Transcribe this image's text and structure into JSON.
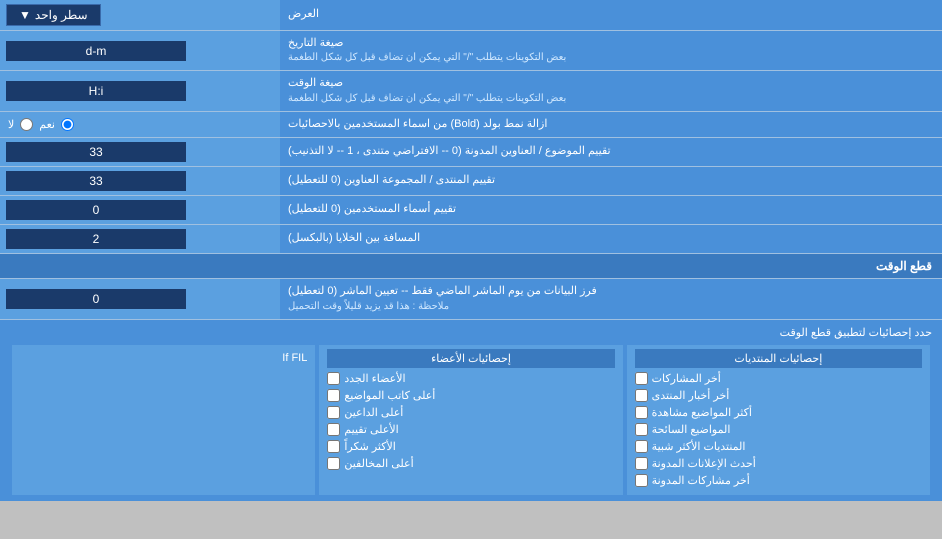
{
  "rows": [
    {
      "id": "display-mode",
      "label": "العرض",
      "input_type": "dropdown",
      "input_value": "سطر واحد"
    },
    {
      "id": "date-format",
      "label": "صيغة التاريخ",
      "sub_label": "بعض التكوينات يتطلب \"/\" التي يمكن ان تضاف قبل كل شكل الطغمة",
      "input_type": "text",
      "input_value": "d-m"
    },
    {
      "id": "time-format",
      "label": "صيغة الوقت",
      "sub_label": "بعض التكوينات يتطلب \"/\" التي يمكن ان تضاف قبل كل شكل الطغمة",
      "input_type": "text",
      "input_value": "H:i"
    },
    {
      "id": "bold-remove",
      "label": "ازالة نمط بولد (Bold) من اسماء المستخدمين بالاحصائيات",
      "input_type": "radio",
      "options": [
        "نعم",
        "لا"
      ],
      "selected": "نعم"
    },
    {
      "id": "topic-order",
      "label": "تقييم الموضوع / العناوين المدونة (0 -- الافتراضي متندى ، 1 -- لا التذنيب)",
      "input_type": "text",
      "input_value": "33"
    },
    {
      "id": "forum-order",
      "label": "تقييم المنتدى / المجموعة العناوين (0 للتعطيل)",
      "input_type": "text",
      "input_value": "33"
    },
    {
      "id": "usernames-order",
      "label": "تقييم أسماء المستخدمين (0 للتعطيل)",
      "input_type": "text",
      "input_value": "0"
    },
    {
      "id": "cell-spacing",
      "label": "المسافة بين الخلايا (بالبكسل)",
      "input_type": "text",
      "input_value": "2"
    }
  ],
  "section_cutoff": {
    "title": "قطع الوقت",
    "row_label": "فرز البيانات من يوم الماشر الماضي فقط -- تعيين الماشر (0 لتعطيل)",
    "note": "ملاحظة : هذا قد يزيد قليلاً وقت التحميل",
    "input_value": "0"
  },
  "stats_section": {
    "title": "حدد إحصائيات لتطبيق قطع الوقت",
    "col1_header": "إحصائيات المنتديات",
    "col1_items": [
      "أخر المشاركات",
      "أخر أخبار المنتدى",
      "أكثر المواضيع مشاهدة",
      "المواضيع السائحة",
      "المنتديات الأكثر شبية",
      "أحدث الإعلانات المدونة",
      "أخر مشاركات المدونة"
    ],
    "col2_header": "إحصائيات الأعضاء",
    "col2_items": [
      "الأعضاء الجدد",
      "أعلى كاتب المواضيع",
      "أعلى الداعين",
      "الأعلى تقييم",
      "الأكثر شكراً",
      "أعلى المخالفين"
    ],
    "col3_header": ""
  },
  "bottom_text": "If FIL"
}
